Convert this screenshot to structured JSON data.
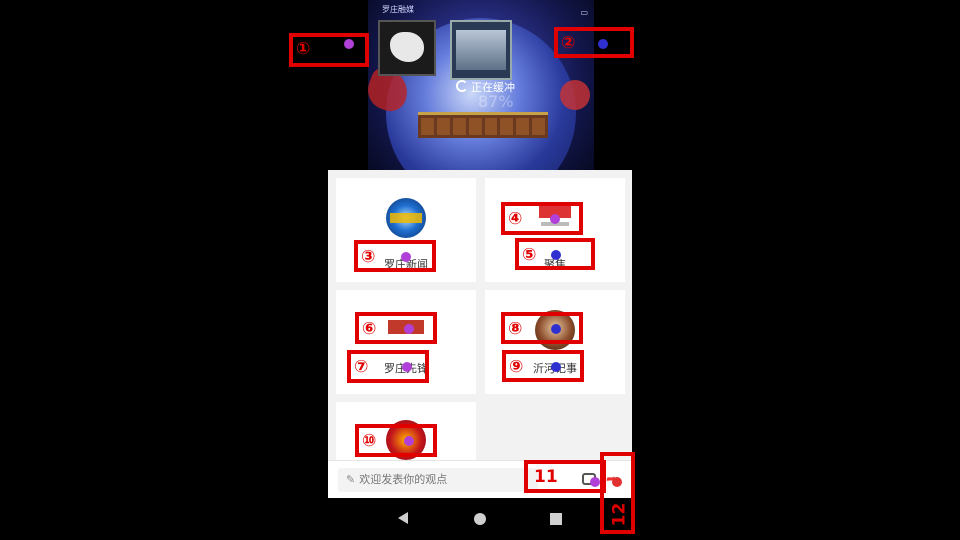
{
  "video": {
    "channel_name": "罗庄融媒",
    "buffering_text": "正在缓冲",
    "buffer_percent": "87%"
  },
  "channels": [
    {
      "label": "罗庄新闻",
      "logo": "luozhuang-news-logo"
    },
    {
      "label": "聚焦",
      "logo": "focus-logo"
    },
    {
      "label": "罗庄先锋",
      "logo": "luozhuang-pioneer-logo"
    },
    {
      "label": "沂河记事",
      "logo": "yihe-memo-logo"
    },
    {
      "label": "",
      "logo": "power-logo"
    }
  ],
  "comment": {
    "placeholder": "欢迎发表你的观点"
  },
  "annotations": [
    {
      "label": "①",
      "dot": "#b040d8"
    },
    {
      "label": "②",
      "dot": "#3030d0"
    },
    {
      "label": "③",
      "dot": "#b040d8"
    },
    {
      "label": "④",
      "dot": "#b040d8"
    },
    {
      "label": "⑤",
      "dot": "#3030d0"
    },
    {
      "label": "⑥",
      "dot": "#b040d8"
    },
    {
      "label": "⑦",
      "dot": "#b040d8"
    },
    {
      "label": "⑧",
      "dot": "#3030d0"
    },
    {
      "label": "⑨",
      "dot": "#3030d0"
    },
    {
      "label": "⑩",
      "dot": "#b040d8"
    },
    {
      "label": "11",
      "dot": "#b040d8"
    },
    {
      "label": "12",
      "dot": "#e03030"
    }
  ],
  "colors": {
    "annotation": "#e00000",
    "panel_bg": "#f2f2f2"
  }
}
